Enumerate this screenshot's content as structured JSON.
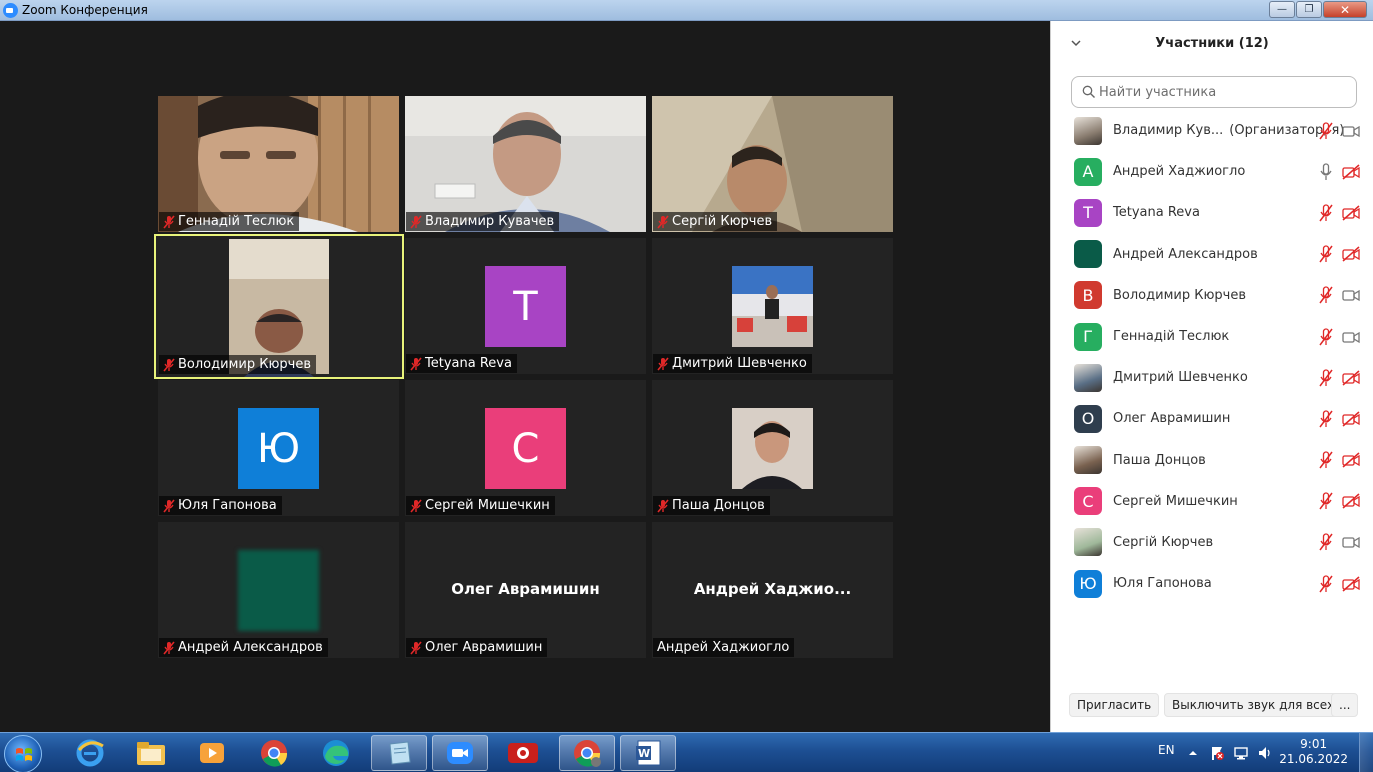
{
  "window": {
    "title": "Zoom Конференция"
  },
  "tiles": [
    {
      "name": "Геннадій Теслюк",
      "kind": "video"
    },
    {
      "name": "Владимир Кувачев",
      "kind": "video"
    },
    {
      "name": "Сергій Кюрчев",
      "kind": "video"
    },
    {
      "name": "Володимир Кюрчев",
      "kind": "video",
      "speaking": true
    },
    {
      "name": "Tetyana Reva",
      "kind": "avatar",
      "letter": "T",
      "color": "#a844c4"
    },
    {
      "name": "Дмитрий Шевченко",
      "kind": "photo"
    },
    {
      "name": "Юля Гапонова",
      "kind": "avatar",
      "letter": "Ю",
      "color": "#0f7fd8"
    },
    {
      "name": "Сергей Мишечкин",
      "kind": "avatar",
      "letter": "С",
      "color": "#ea3e7a"
    },
    {
      "name": "Паша Донцов",
      "kind": "photo"
    },
    {
      "name": "Андрей Александров",
      "kind": "avatar",
      "letter": "",
      "color": "#0a5b48"
    },
    {
      "name": "Олег Аврамишин",
      "kind": "name",
      "display": "Олег Аврамишин"
    },
    {
      "name": "Андрей Хаджиогло",
      "kind": "name",
      "display": "Андрей  Хаджио...",
      "muted": false
    }
  ],
  "panel": {
    "title": "Участники (12)",
    "search_placeholder": "Найти участника",
    "participants": [
      {
        "name": "Владимир Кув...",
        "role": "(Организатор, я)",
        "avatar": "photo",
        "color": "#8a7d70",
        "mic": "muted",
        "cam": "on"
      },
      {
        "name": "Андрей Хаджиогло",
        "avatar": "letter",
        "letter": "А",
        "color": "#27ae60",
        "mic": "on",
        "cam": "off"
      },
      {
        "name": "Tetyana Reva",
        "avatar": "letter",
        "letter": "T",
        "color": "#a844c4",
        "mic": "muted",
        "cam": "off"
      },
      {
        "name": "Андрей Александров",
        "avatar": "letter",
        "letter": "",
        "color": "#0a5b48",
        "mic": "muted",
        "cam": "off"
      },
      {
        "name": "Володимир Кюрчев",
        "avatar": "letter",
        "letter": "В",
        "color": "#d03a2f",
        "mic": "muted",
        "cam": "on"
      },
      {
        "name": "Геннадій Теслюк",
        "avatar": "letter",
        "letter": "Г",
        "color": "#27ae60",
        "mic": "muted",
        "cam": "on"
      },
      {
        "name": "Дмитрий Шевченко",
        "avatar": "photo",
        "color": "#5a6f86",
        "mic": "muted",
        "cam": "off"
      },
      {
        "name": "Олег Аврамишин",
        "avatar": "letter",
        "letter": "О",
        "color": "#2f3e4e",
        "mic": "muted",
        "cam": "off"
      },
      {
        "name": "Паша Донцов",
        "avatar": "photo",
        "color": "#7a6250",
        "mic": "muted",
        "cam": "off"
      },
      {
        "name": "Сергей Мишечкин",
        "avatar": "letter",
        "letter": "С",
        "color": "#ea3e7a",
        "mic": "muted",
        "cam": "off"
      },
      {
        "name": "Сергій Кюрчев",
        "avatar": "photo",
        "color": "#9fb89a",
        "mic": "muted",
        "cam": "on"
      },
      {
        "name": "Юля Гапонова",
        "avatar": "letter",
        "letter": "Ю",
        "color": "#0f7fd8",
        "mic": "muted",
        "cam": "off"
      }
    ],
    "invite_label": "Пригласить",
    "mute_all_label": "Выключить звук для всех",
    "more_label": "..."
  },
  "taskbar": {
    "lang": "EN",
    "time": "9:01",
    "date": "21.06.2022",
    "apps": [
      "windows-explorer-icon",
      "internet-explorer-icon",
      "folder-icon",
      "media-player-icon",
      "chrome-icon",
      "edge-icon",
      "notepad-icon",
      "zoom-icon",
      "red-app-icon",
      "chrome-profile-icon",
      "word-icon"
    ]
  }
}
